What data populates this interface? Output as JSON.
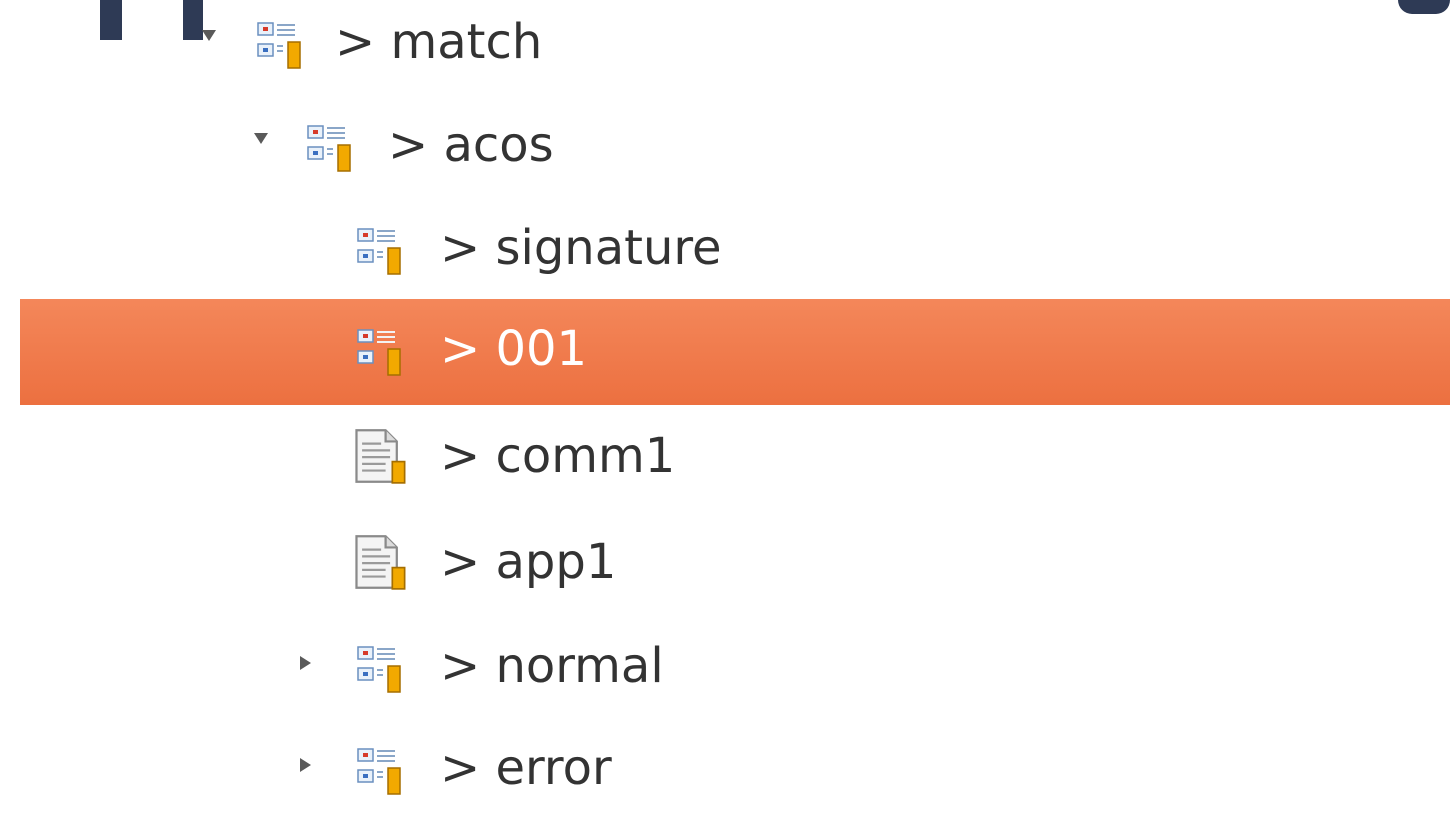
{
  "tree": {
    "nodes": [
      {
        "label": "> match",
        "icon": "entity-icon",
        "state": "expanded"
      },
      {
        "label": "> acos",
        "icon": "entity-icon",
        "state": "expanded"
      },
      {
        "label": "> signature",
        "icon": "entity-icon",
        "state": "leaf"
      },
      {
        "label": "> 001",
        "icon": "entity-icon",
        "state": "leaf",
        "selected": true
      },
      {
        "label": "> comm1",
        "icon": "document-icon",
        "state": "leaf"
      },
      {
        "label": "> app1",
        "icon": "document-icon",
        "state": "leaf"
      },
      {
        "label": "> normal",
        "icon": "entity-icon",
        "state": "collapsed"
      },
      {
        "label": "> error",
        "icon": "entity-icon",
        "state": "collapsed"
      }
    ]
  },
  "colors": {
    "selection": "#ef7b4b",
    "text": "#333333",
    "selected_text": "#ffffff"
  }
}
